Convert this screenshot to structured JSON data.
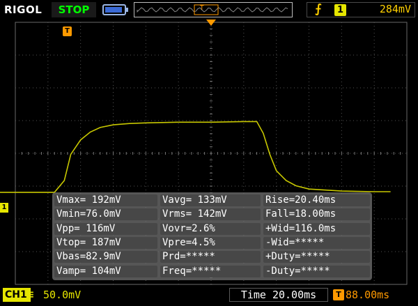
{
  "header": {
    "brand": "RIGOL",
    "run_state": "STOP",
    "trigger_channel": "1",
    "trigger_level": "284mV",
    "trigger_pos_label": "T"
  },
  "icons": {
    "battery": "battery-icon",
    "edge": "rising-edge-icon",
    "trigger_marker": "trigger-position-icon"
  },
  "markers": {
    "trigger_tag": "T",
    "channel_ground": "1"
  },
  "measurements": [
    [
      "Vmax= 192mV",
      "Vavg= 133mV",
      "Rise=20.40ms"
    ],
    [
      "Vmin=76.0mV",
      "Vrms= 142mV",
      "Fall=18.00ms"
    ],
    [
      "Vpp= 116mV",
      "Vovr=2.6%",
      "+Wid=116.0ms"
    ],
    [
      "Vtop= 187mV",
      "Vpre=4.5%",
      "-Wid=*****"
    ],
    [
      "Vbas=82.9mV",
      "Prd=*****",
      "+Duty=*****"
    ],
    [
      "Vamp= 104mV",
      "Freq=*****",
      "-Duty=*****"
    ]
  ],
  "footer": {
    "channel": "CH1",
    "coupling": "≡",
    "scale": "50.0mV",
    "timebase": "Time 20.00ms",
    "hpos_icon": "T",
    "hpos": "88.00ms"
  },
  "colors": {
    "trace": "#c8c800",
    "channel": "#e6e600",
    "trigger": "#ff9a00",
    "run_state": "#00ff00"
  },
  "chart_data": {
    "type": "line",
    "series": [
      {
        "name": "CH1",
        "x": [
          -0.5,
          1.2,
          1.5,
          1.7,
          2.0,
          2.3,
          2.6,
          3.0,
          3.5,
          4.0,
          5.0,
          6.0,
          7.0,
          7.4,
          7.6,
          7.8,
          8.0,
          8.3,
          8.6,
          9.0,
          10.0,
          11.0,
          11.5
        ],
        "y": [
          82,
          82,
          100,
          140,
          162,
          174,
          181,
          185,
          187,
          188,
          189,
          189,
          190,
          190,
          172,
          140,
          115,
          100,
          92,
          87,
          84,
          83,
          83
        ]
      }
    ],
    "xlabel": "Time (ms)",
    "ylabel": "mV",
    "grid": true
  }
}
